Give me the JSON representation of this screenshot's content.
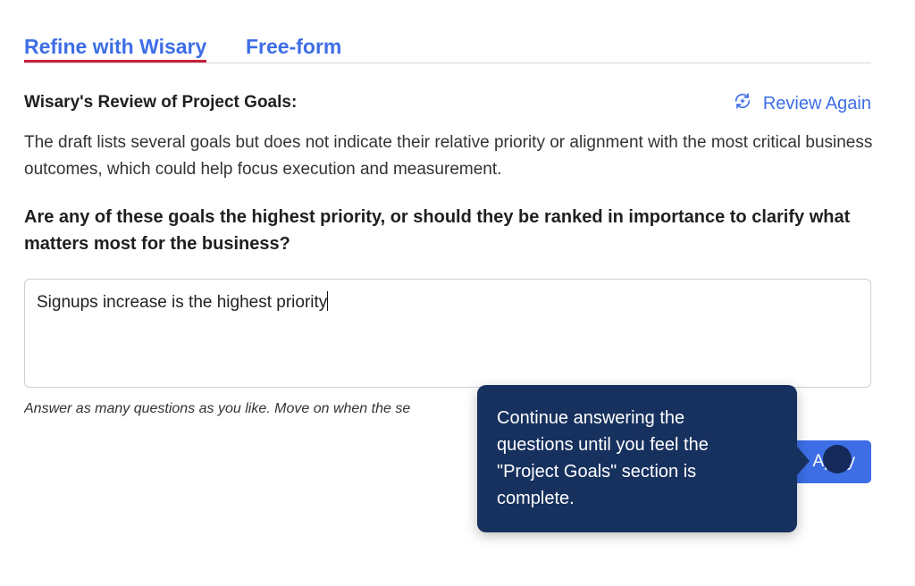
{
  "tabs": [
    {
      "label": "Refine with Wisary",
      "active": true
    },
    {
      "label": "Free-form",
      "active": false
    }
  ],
  "review": {
    "heading": "Wisary's Review of Project Goals:",
    "review_again_label": "Review Again",
    "review_again_icon": "refresh-sparkle-icon",
    "text": "The draft lists several goals but does not indicate their relative priority or alignment with the most critical business outcomes, which could help focus execution and measurement."
  },
  "question": "Are any of these goals the highest priority, or should they be ranked in importance to clarify what matters most for the business?",
  "answer": {
    "value": "Signups increase is the highest priority"
  },
  "hint": "Answer as many questions as you like. Move on when the se",
  "apply_button": {
    "label": "Apply"
  },
  "tooltip": {
    "text": "Continue answering the questions until you feel the \"Project Goals\" section is complete."
  },
  "colors": {
    "accent": "#3d6ee6",
    "tab_underline": "#c8203a",
    "tooltip_bg": "#17315e"
  }
}
